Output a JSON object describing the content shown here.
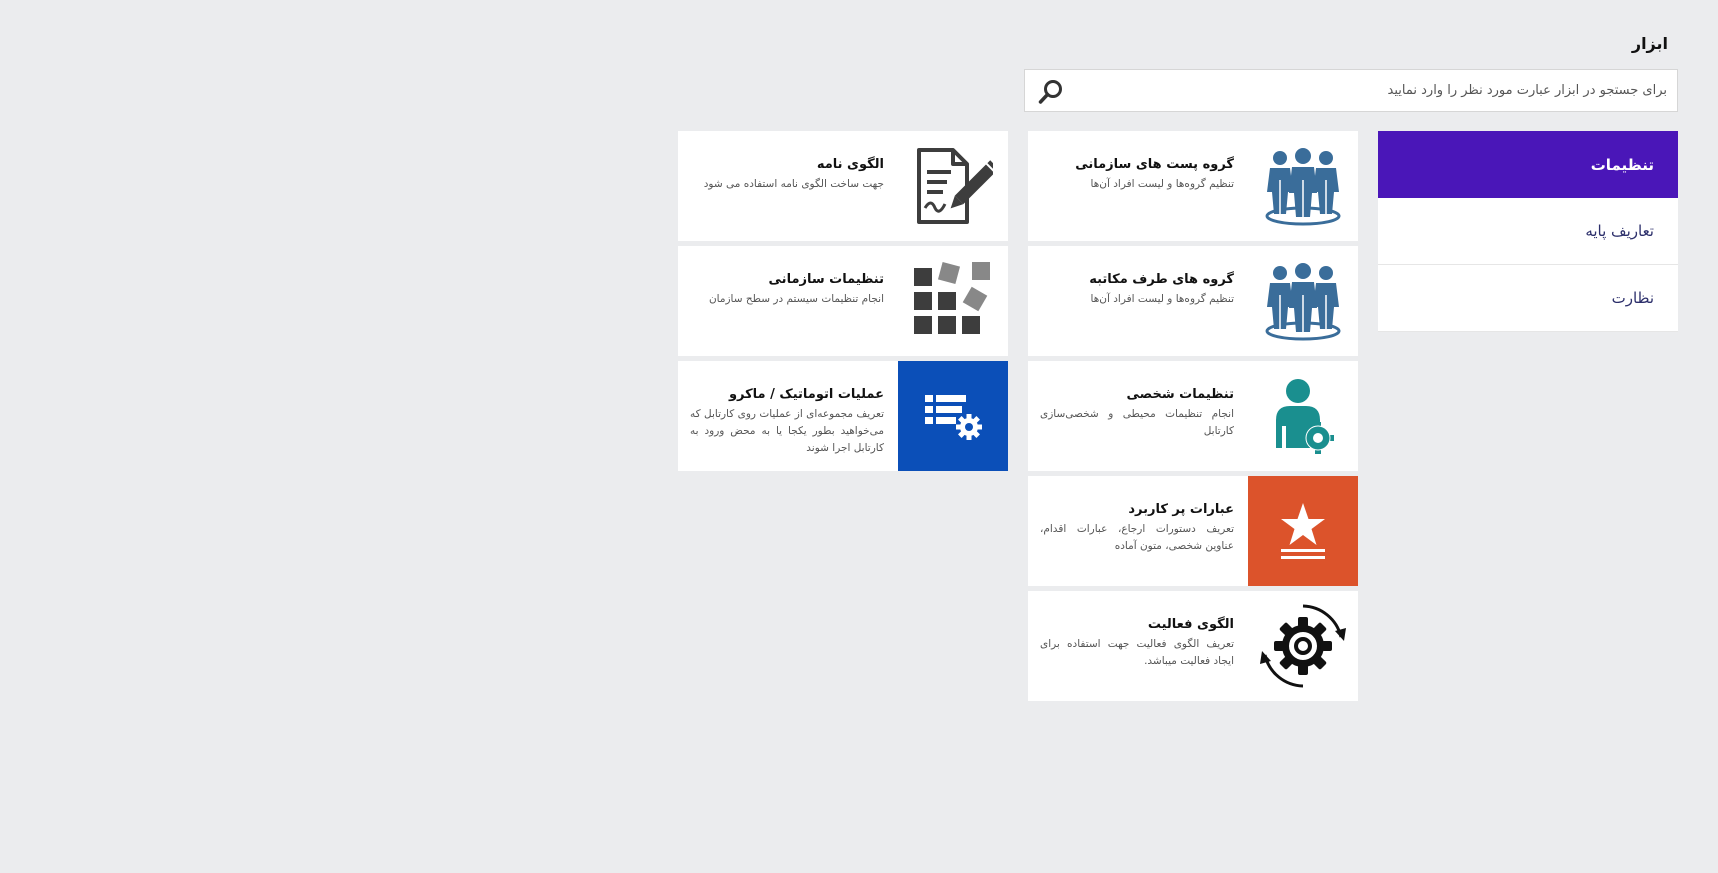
{
  "page": {
    "title": "ابزار"
  },
  "search": {
    "placeholder": "برای جستجو در ابزار عبارت مورد نظر را وارد نمایید",
    "value": ""
  },
  "sidebar": {
    "items": [
      {
        "label": "تنظیمات",
        "active": true
      },
      {
        "label": "تعاریف پایه",
        "active": false
      },
      {
        "label": "نظارت",
        "active": false
      }
    ]
  },
  "cards": [
    {
      "title": "گروه پست های سازمانی",
      "desc": "تنظیم گروه‌ها و لیست افراد آن‌ها",
      "icon": "people-group-icon"
    },
    {
      "title": "گروه های طرف مکاتبه",
      "desc": "تنظیم گروه‌ها و لیست افراد آن‌ها",
      "icon": "people-group-icon"
    },
    {
      "title": "تنظیمات شخصی",
      "desc": "انجام تنظیمات محیطی و شخصی‌سازی کارتابل",
      "icon": "user-settings-icon"
    },
    {
      "title": "عبارات پر کاربرد",
      "desc": "تعریف دستورات ارجاع، عبارات اقدام، عناوین شخصی، متون آماده",
      "icon": "star-list-icon"
    },
    {
      "title": "الگوی فعالیت",
      "desc": "تعریف الگوی فعالیت جهت استفاده برای ایجاد فعالیت میباشد.",
      "icon": "gear-cycle-icon"
    },
    {
      "title": "الگوی نامه",
      "desc": "جهت ساخت الگوی نامه استفاده می شود",
      "icon": "document-pen-icon"
    },
    {
      "title": "تنظیمات سازمانی",
      "desc": "انجام تنظیمات سیستم در سطح سازمان",
      "icon": "blocks-grid-icon"
    },
    {
      "title": "عملیات اتوماتیک / ماکرو",
      "desc": "تعریف مجموعه‌ای از عملیات روی کارتابل که می‌خواهید بطور یکجا یا به محض ورود به کارتابل اجرا شوند",
      "icon": "list-gear-icon"
    }
  ],
  "colors": {
    "background": "#ebecee",
    "sidebar_active": "#4a16b8",
    "people_icon": "#3a6d9a",
    "user_icon": "#1a8f8f",
    "star_tile": "#dc532b",
    "macro_tile": "#0b4fb8",
    "dark_icon": "#3d3d3d"
  }
}
